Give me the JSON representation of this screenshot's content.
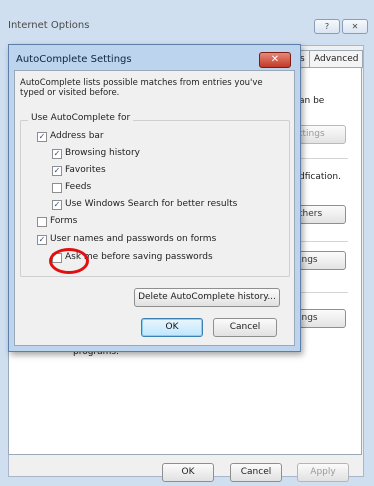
{
  "window": {
    "title": "Internet Options",
    "help_button": "?",
    "close_button": "✕"
  },
  "tabs": [
    {
      "label": "s"
    },
    {
      "label": "Advanced"
    }
  ],
  "background_text": {
    "line1": "an be",
    "line2": "dfication.",
    "programs": "programs."
  },
  "background_buttons": {
    "settings1": "ttings",
    "others": "thers",
    "settings2": "ings",
    "settings3": "ings"
  },
  "footer": {
    "ok": "OK",
    "cancel": "Cancel",
    "apply": "Apply"
  },
  "dialog": {
    "title": "AutoComplete Settings",
    "close": "✕",
    "intro": "AutoComplete lists possible matches from entries you've typed or visited before.",
    "group_label": "Use AutoComplete for",
    "options": {
      "address_bar": {
        "label": "Address bar",
        "checked": true
      },
      "browsing_history": {
        "label": "Browsing history",
        "checked": true
      },
      "favorites": {
        "label": "Favorites",
        "checked": true
      },
      "feeds": {
        "label": "Feeds",
        "checked": false
      },
      "windows_search": {
        "label": "Use Windows Search for better results",
        "checked": true
      },
      "forms": {
        "label": "Forms",
        "checked": false
      },
      "usernames_passwords": {
        "label": "User names and passwords on forms",
        "checked": true
      },
      "ask_before_saving": {
        "label": "Ask me before saving passwords",
        "checked": false
      }
    },
    "delete_history_button": "Delete AutoComplete history...",
    "ok_button": "OK",
    "cancel_button": "Cancel"
  },
  "checkmark": "✓",
  "colors": {
    "annotation": "#e01010",
    "title_bar": "#bcd4ee",
    "close_button": "#c13a26"
  }
}
